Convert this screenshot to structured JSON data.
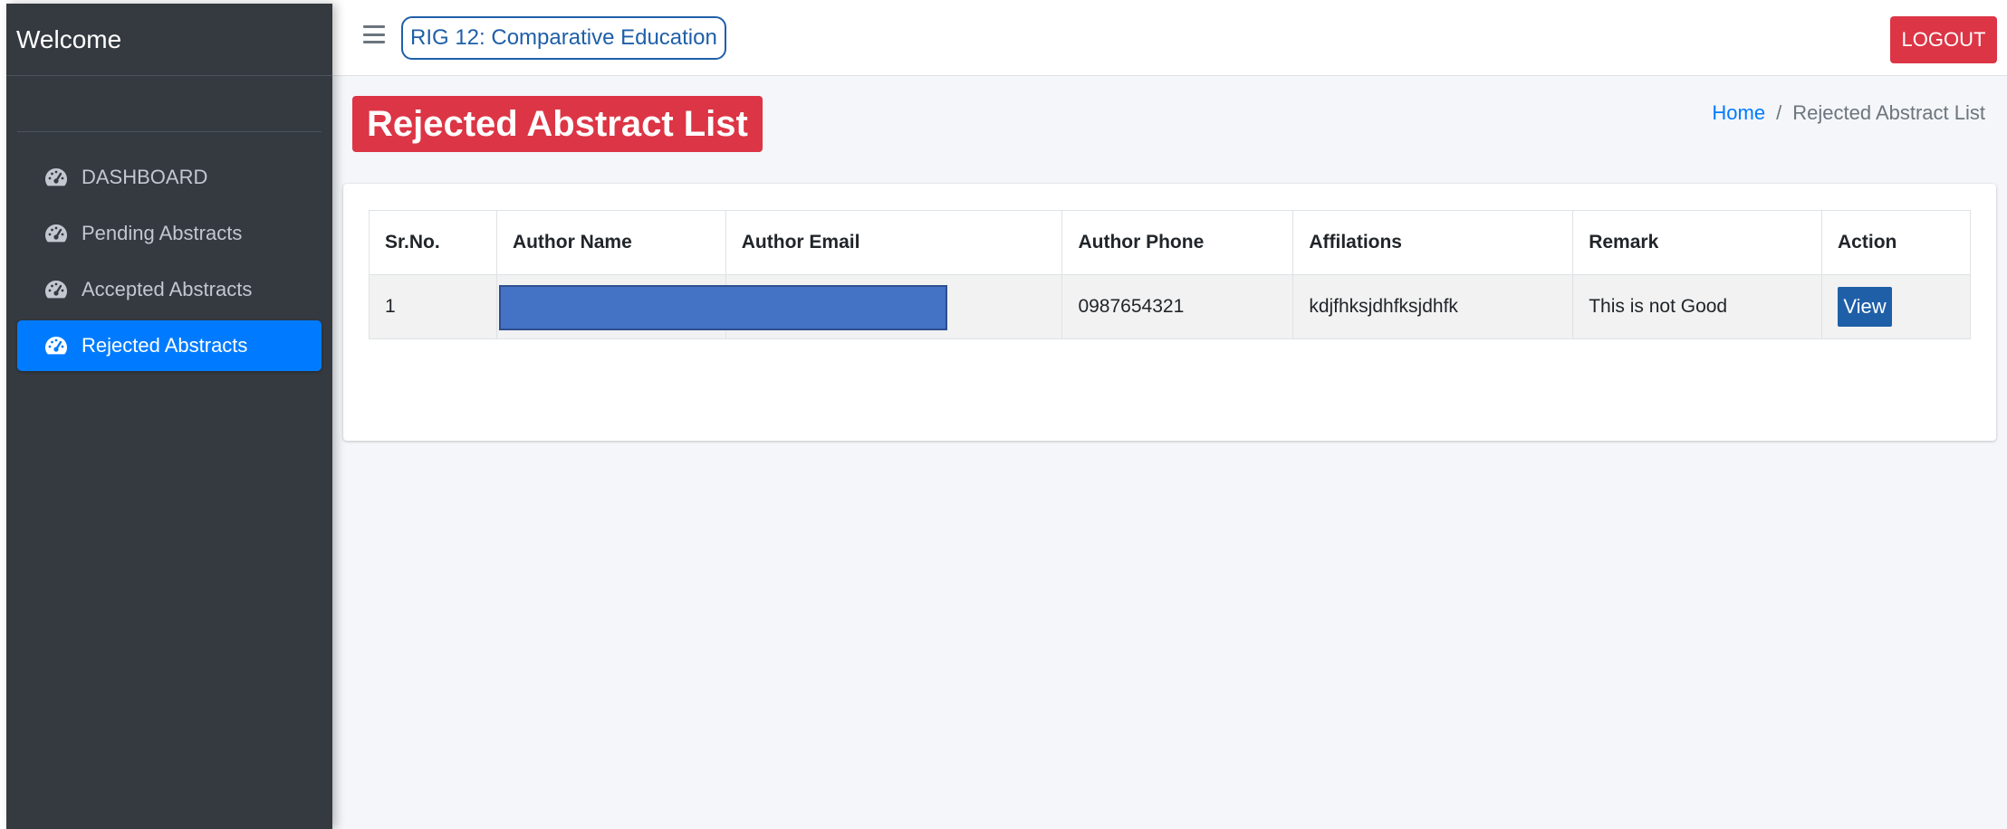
{
  "sidebar": {
    "brand": "Welcome",
    "items": [
      {
        "label": "DASHBOARD",
        "icon": "tachometer-icon",
        "active": false
      },
      {
        "label": "Pending Abstracts",
        "icon": "tachometer-icon",
        "active": false
      },
      {
        "label": "Accepted Abstracts",
        "icon": "tachometer-icon",
        "active": false
      },
      {
        "label": "Rejected Abstracts",
        "icon": "tachometer-icon",
        "active": true
      }
    ]
  },
  "navbar": {
    "menu_icon": "hamburger-icon",
    "course": "RIG 12: Comparative Education",
    "logout": "LOGOUT"
  },
  "page": {
    "title": "Rejected Abstract List",
    "breadcrumb": {
      "home": "Home",
      "separator": "/",
      "current": "Rejected Abstract List"
    }
  },
  "table": {
    "headers": [
      "Sr.No.",
      "Author Name",
      "Author Email",
      "Author Phone",
      "Affilations",
      "Remark",
      "Action"
    ],
    "rows": [
      {
        "sr": "1",
        "name": "",
        "email": "",
        "phone": "0987654321",
        "affiliation": "kdjfhksjdhfksjdhfk",
        "remark": "This is not Good",
        "action": "View"
      }
    ]
  },
  "colors": {
    "sidebar_bg": "#343a40",
    "active_nav": "#007bff",
    "danger": "#dc3545",
    "primary_dark": "#1f5fa8",
    "redaction": "#4472c4"
  }
}
